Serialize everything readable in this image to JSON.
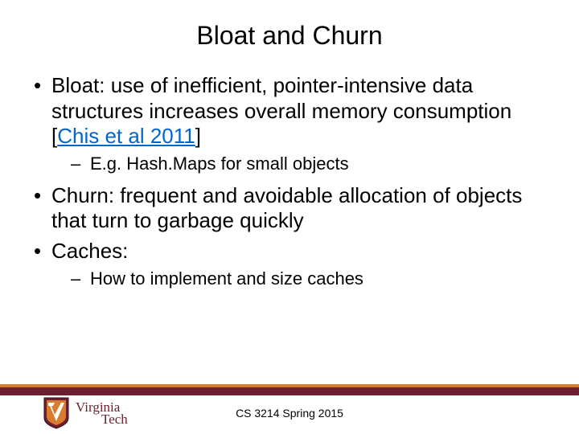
{
  "title": "Bloat and Churn",
  "bullets": [
    {
      "pre": "Bloat: use of inefficient, pointer-intensive data structures increases overall memory consumption [",
      "link": "Chis et al 2011",
      "post": "]",
      "sub": [
        "E.g. Hash.Maps for small objects"
      ]
    },
    {
      "text": "Churn: frequent and avoidable allocation of objects that turn to garbage quickly"
    },
    {
      "text": "Caches:",
      "sub": [
        "How to implement and size caches"
      ]
    }
  ],
  "footer": "CS 3214 Spring 2015",
  "logo": {
    "word1": "Virginia",
    "word2": "Tech"
  }
}
